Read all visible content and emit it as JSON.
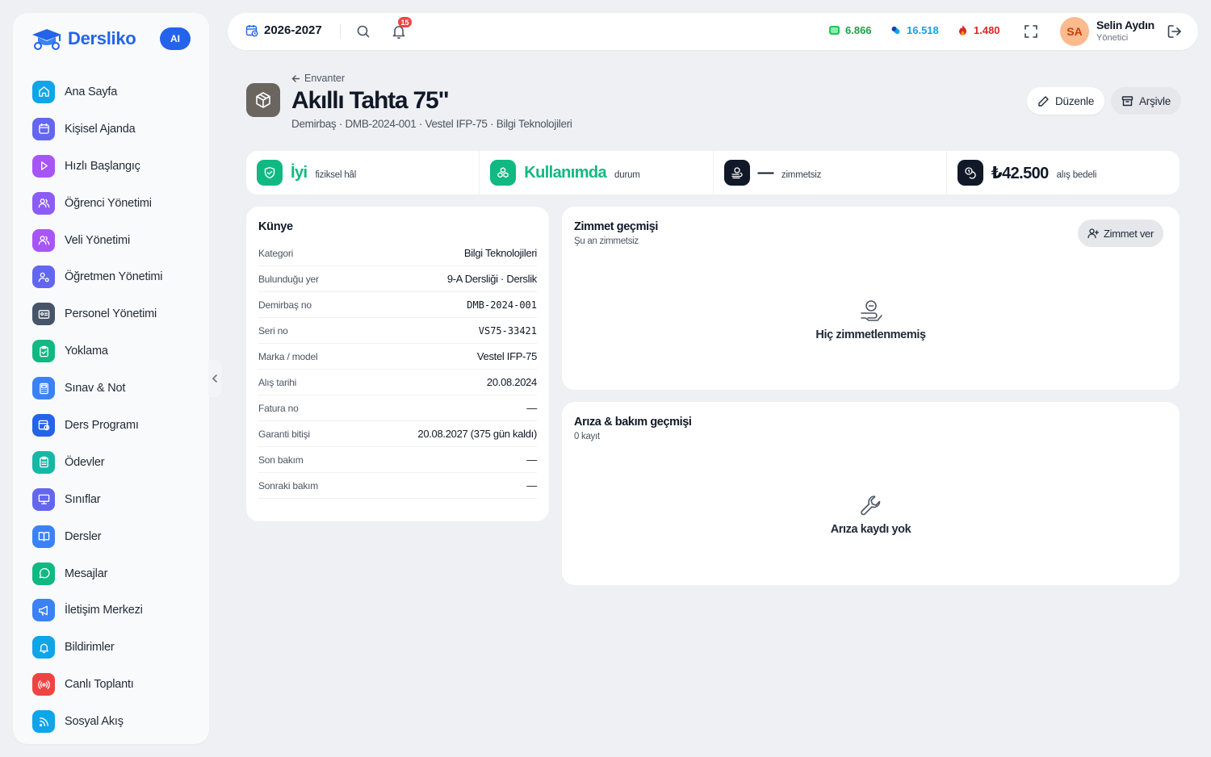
{
  "brand": {
    "name": "Dersliko",
    "ai_label": "AI",
    "color": "#2563eb"
  },
  "sidebar": {
    "items": [
      {
        "label": "Ana Sayfa",
        "icon": "home-icon",
        "color": "#0ea5e9"
      },
      {
        "label": "Kişisel Ajanda",
        "icon": "calendar-icon",
        "color": "#6366f1"
      },
      {
        "label": "Hızlı Başlangıç",
        "icon": "play-icon",
        "color": "#a855f7"
      },
      {
        "label": "Öğrenci Yönetimi",
        "icon": "users-icon",
        "color": "#8b5cf6"
      },
      {
        "label": "Veli Yönetimi",
        "icon": "users-icon",
        "color": "#a855f7"
      },
      {
        "label": "Öğretmen Yönetimi",
        "icon": "user-cog-icon",
        "color": "#6366f1"
      },
      {
        "label": "Personel Yönetimi",
        "icon": "id-card-icon",
        "color": "#475569"
      },
      {
        "label": "Yoklama",
        "icon": "clipboard-check-icon",
        "color": "#10b981"
      },
      {
        "label": "Sınav & Not",
        "icon": "calculator-icon",
        "color": "#3b82f6"
      },
      {
        "label": "Ders Programı",
        "icon": "calendar-clock-icon",
        "color": "#2563eb"
      },
      {
        "label": "Ödevler",
        "icon": "clipboard-list-icon",
        "color": "#14b8a6"
      },
      {
        "label": "Sınıflar",
        "icon": "presentation-icon",
        "color": "#6366f1"
      },
      {
        "label": "Dersler",
        "icon": "book-open-icon",
        "color": "#3b82f6"
      },
      {
        "label": "Mesajlar",
        "icon": "message-circle-icon",
        "color": "#10b981"
      },
      {
        "label": "İletişim Merkezi",
        "icon": "megaphone-icon",
        "color": "#3b82f6"
      },
      {
        "label": "Bildirimler",
        "icon": "bell-icon",
        "color": "#0ea5e9"
      },
      {
        "label": "Canlı Toplantı",
        "icon": "radio-icon",
        "color": "#ef4444"
      },
      {
        "label": "Sosyal Akış",
        "icon": "rss-icon",
        "color": "#0ea5e9"
      }
    ]
  },
  "topbar": {
    "year": "2026-2027",
    "notification_count": "15",
    "stats": [
      {
        "value": "6.866",
        "color": "#16a34a",
        "icon": "cash-icon"
      },
      {
        "value": "16.518",
        "color": "#0ea5e9",
        "icon": "pill-icon"
      },
      {
        "value": "1.480",
        "color": "#dc2626",
        "icon": "flame-icon"
      }
    ],
    "user": {
      "initials": "SA",
      "name": "Selin Aydın",
      "role": "Yönetici"
    }
  },
  "header": {
    "breadcrumb": "Envanter",
    "title": "Akıllı Tahta 75\"",
    "subtitle": "Demirbaş · DMB-2024-001 · Vestel IFP-75 · Bilgi Teknolojileri",
    "edit_label": "Düzenle",
    "archive_label": "Arşivle"
  },
  "strip": [
    {
      "value": "İyi",
      "caption": "fiziksel hâl",
      "color": "#10b981",
      "icon": "shield-check-icon"
    },
    {
      "value": "Kullanımda",
      "caption": "durum",
      "color": "#10b981",
      "icon": "boxes-icon"
    },
    {
      "value": "—",
      "caption": "zimmetsiz",
      "color": "#111827",
      "icon": "hand-coins-icon"
    },
    {
      "value": "₺42.500",
      "caption": "alış bedeli",
      "color": "#111827",
      "icon": "coins-icon"
    }
  ],
  "kunye": {
    "title": "Künye",
    "rows": [
      {
        "key": "Kategori",
        "value": "Bilgi Teknolojileri"
      },
      {
        "key": "Bulunduğu yer",
        "value": "9-A Dersliği · Derslik"
      },
      {
        "key": "Demirbaş no",
        "value": "DMB-2024-001"
      },
      {
        "key": "Seri no",
        "value": "VS75-33421"
      },
      {
        "key": "Marka / model",
        "value": "Vestel IFP-75"
      },
      {
        "key": "Alış tarihi",
        "value": "20.08.2024"
      },
      {
        "key": "Fatura no",
        "value": "—"
      },
      {
        "key": "Garanti bitişi",
        "value": "20.08.2027 (375 gün kaldı)"
      },
      {
        "key": "Son bakım",
        "value": "—"
      },
      {
        "key": "Sonraki bakım",
        "value": "—"
      }
    ]
  },
  "zimmet": {
    "title": "Zimmet geçmişi",
    "subtitle": "Şu an zimmetsiz",
    "button_label": "Zimmet ver",
    "empty_text": "Hiç zimmetlenmemiş"
  },
  "ariza": {
    "title": "Arıza & bakım geçmişi",
    "subtitle": "0 kayıt",
    "empty_text": "Arıza kaydı yok"
  }
}
